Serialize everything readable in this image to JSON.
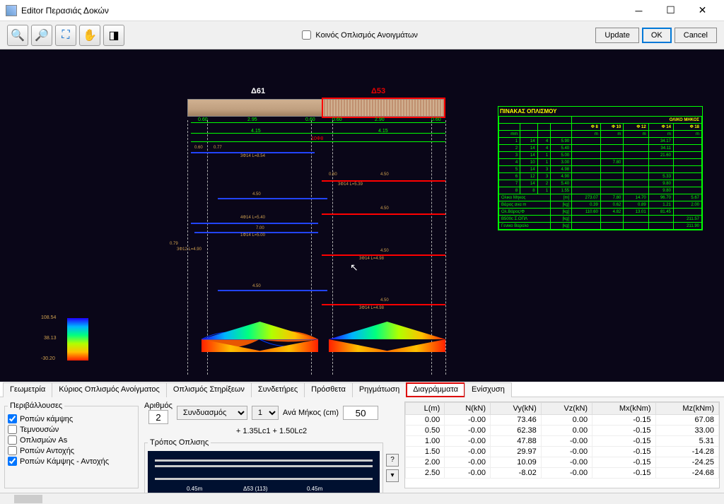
{
  "window": {
    "title": "Editor Περασιάς Δοκών"
  },
  "toolbar": {
    "checkbox_label": "Κοινός Οπλισμός Ανοιγμάτων",
    "update": "Update",
    "ok": "OK",
    "cancel": "Cancel"
  },
  "beams": {
    "d61": "Δ61",
    "d53": "Δ53"
  },
  "green_dims_top": [
    "0.60",
    "2.95",
    "0.60",
    "0.60",
    "2.90",
    "0.60"
  ],
  "green_dims_long": [
    "4.15",
    "4.15"
  ],
  "red_mark": "10Φ8",
  "mark_texts": [
    "3Φ14 L=8.54",
    "3Φ14 L=5.39",
    "3Φ14 L=4.90",
    "4Φ14 L=5.40",
    "1Φ14 L=5.00",
    "3Φ14 L=4.98",
    "3Φ12 L=4.90",
    "3Φ14 L=4.98"
  ],
  "dim_texts": [
    "0.60",
    "0.77",
    "0.79",
    "7.00",
    "0.60",
    "0.60",
    "4.50",
    "4.50",
    "4.50",
    "4.50",
    "0.60",
    "0.60"
  ],
  "legend": {
    "top": "108.54",
    "mid": "38.13",
    "bot": "-30.20"
  },
  "rebar_table": {
    "title": "ΠΙΝΑΚΑΣ ΟΠΛΙΣΜΟΥ",
    "subtitle": "ΟΛΙΚΟ ΜΗΚΟΣ",
    "diam_headers": [
      "Φ 8",
      "Φ 10",
      "Φ 12",
      "Φ 14",
      "Φ 18"
    ],
    "unit_row": [
      "m",
      "m",
      "m",
      "m",
      "m"
    ],
    "rows": [
      [
        "1",
        " 14",
        " 4",
        " 5.90",
        "",
        "",
        "",
        "34.17",
        ""
      ],
      [
        "2",
        " 14",
        " 4",
        " 5.40",
        "",
        "",
        "",
        "34.11",
        ""
      ],
      [
        "3",
        " 14",
        " 1",
        " 5.00",
        "",
        "",
        "",
        "21.60",
        ""
      ],
      [
        "4",
        " 10",
        " 1",
        " 3.00",
        "",
        "7.80",
        "",
        "",
        ""
      ],
      [
        "5",
        " 14",
        " 3",
        " 4.98",
        "",
        "",
        "",
        "",
        ""
      ],
      [
        "6",
        " 12",
        " 3",
        " 4.90",
        "",
        "",
        "",
        "5.33",
        ""
      ],
      [
        "7",
        " 14",
        " 2",
        " 5.40",
        "",
        "",
        "",
        "9.80",
        ""
      ],
      [
        "8",
        "  8",
        " 1",
        " 1.55",
        "",
        "",
        "",
        "9.80",
        ""
      ]
    ],
    "summary": [
      [
        "Ολικο Μηκος",
        "[m]",
        "273.07",
        "7.80",
        "14.70",
        "96.70",
        "5.67"
      ],
      [
        "Βάρος ανα m",
        "[kg]",
        " 0.39",
        " 0.62",
        " 0.89",
        " 1.21",
        " 2.00"
      ],
      [
        "Ολ.Βάρος/Φ",
        "[kg]",
        "110.60",
        " 4.82",
        " 13.01",
        " 81.45",
        ""
      ],
      [
        "B500c Σ.ΟΠΛ",
        "[kg]",
        "",
        "",
        "",
        "",
        "211.57"
      ],
      [
        "Γενικο Βαρολο",
        "[kg]",
        "",
        "",
        "",
        "",
        "211.90"
      ]
    ]
  },
  "tabs": [
    "Γεωμετρία",
    "Κύριος Οπλισμός Ανοίγματος",
    "Οπλισμός Στηρίξεων",
    "Συνδετήρες",
    "Πρόσθετα",
    "Ρηγμάτωση",
    "Διαγράμματα",
    "Ενίσχυση"
  ],
  "envelopes": {
    "legend": "Περιβάλλουσες",
    "items": [
      "Ροπών κάμψης",
      "Τεμνουσών",
      "Οπλισμών As",
      "Ροπών Αντοχής",
      "Ροπών Κάμψης - Αντοχής"
    ]
  },
  "controls": {
    "arithmos": "Αριθμός",
    "arithmos_val": "2",
    "combo_label": "Συνδυασμός",
    "combo_sel": "1",
    "ana_mikos": "Ανά Μήκος (cm)",
    "ana_mikos_val": "50",
    "formula": "+ 1.35Lc1 + 1.50Lc2",
    "tropos": "Τρόπος Οπλισης",
    "q": "?"
  },
  "rebar_vis": {
    "left": "0.45m",
    "mid": "Δ53 (113)",
    "right": "0.45m"
  },
  "results": {
    "headers": [
      "L(m)",
      "N(kN)",
      "Vy(kN)",
      "Vz(kN)",
      "Mx(kNm)",
      "Mz(kNm)"
    ],
    "rows": [
      [
        "0.00",
        "-0.00",
        "73.46",
        "0.00",
        "-0.15",
        "67.08"
      ],
      [
        "0.50",
        "-0.00",
        "62.38",
        "0.00",
        "-0.15",
        "33.00"
      ],
      [
        "1.00",
        "-0.00",
        "47.88",
        "-0.00",
        "-0.15",
        "5.31"
      ],
      [
        "1.50",
        "-0.00",
        "29.97",
        "-0.00",
        "-0.15",
        "-14.28"
      ],
      [
        "2.00",
        "-0.00",
        "10.09",
        "-0.00",
        "-0.15",
        "-24.25"
      ],
      [
        "2.50",
        "-0.00",
        "-8.02",
        "-0.00",
        "-0.15",
        "-24.68"
      ]
    ]
  }
}
